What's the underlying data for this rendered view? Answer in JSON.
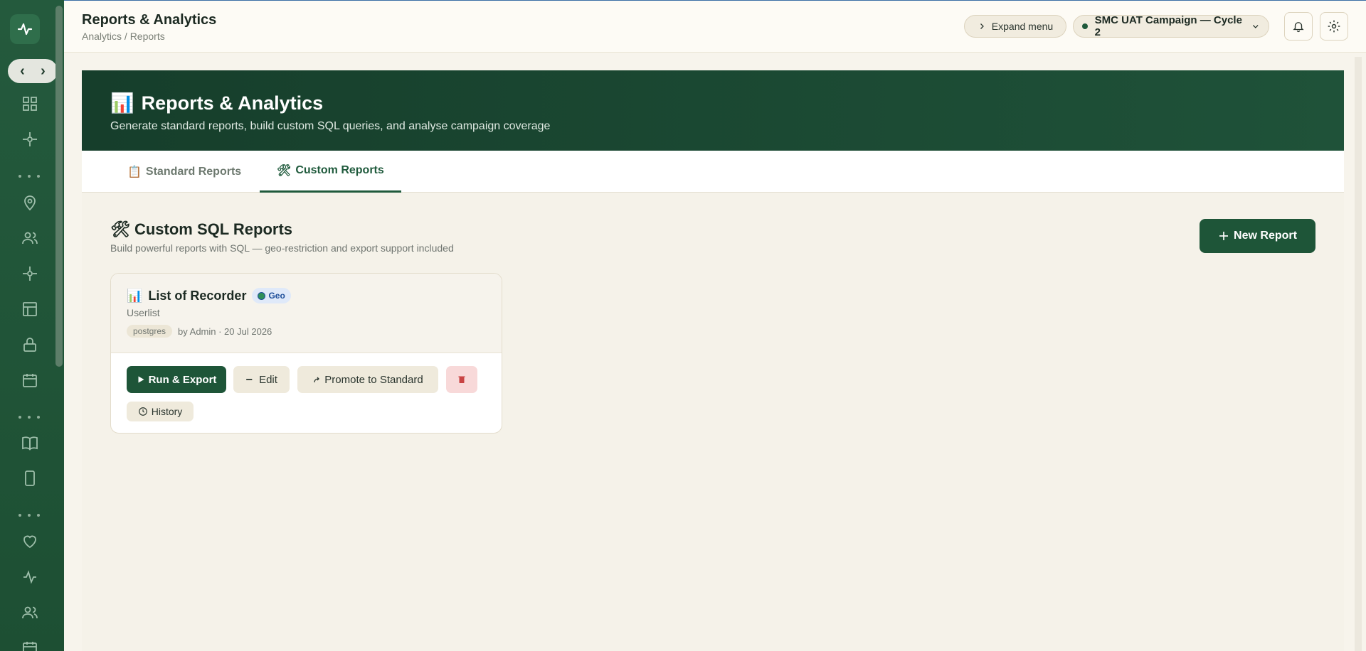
{
  "app": {
    "page_title": "Reports & Analytics",
    "breadcrumb": "Analytics / Reports"
  },
  "topbar": {
    "expand_label": "Expand menu",
    "campaign_label": "SMC UAT Campaign — Cycle 2"
  },
  "sidebar": {
    "toggle_left": "‹",
    "toggle_right": "›",
    "items": [
      {
        "icon": "dashboard-grid-icon"
      },
      {
        "icon": "crosshair-icon"
      },
      {
        "icon": "location-pin-icon"
      },
      {
        "icon": "users-icon"
      },
      {
        "icon": "crosshair-icon"
      },
      {
        "icon": "layout-icon"
      },
      {
        "icon": "lock-icon"
      },
      {
        "icon": "calendar-icon"
      },
      {
        "icon": "book-icon"
      },
      {
        "icon": "mobile-icon"
      },
      {
        "icon": "heart-icon"
      },
      {
        "icon": "activity-icon"
      },
      {
        "icon": "users-icon"
      },
      {
        "icon": "calendar-icon"
      }
    ]
  },
  "hero": {
    "emoji": "📊",
    "title": "Reports & Analytics",
    "subtitle": "Generate standard reports, build custom SQL queries, and analyse campaign coverage"
  },
  "tabs": [
    {
      "emoji": "📋",
      "label": "Standard Reports",
      "active": false
    },
    {
      "emoji": "🛠",
      "label": "Custom Reports",
      "active": true
    }
  ],
  "section": {
    "emoji": "🛠",
    "title": "Custom SQL Reports",
    "subtitle": "Build powerful reports with SQL — geo-restriction and export support included",
    "new_report_label": "New Report"
  },
  "report_card": {
    "emoji": "📊",
    "title": "List of Recorder",
    "badge": "Geo",
    "description": "Userlist",
    "db_tag": "postgres",
    "meta": "by Admin · 20 Jul 2026",
    "actions": {
      "run": "Run & Export",
      "edit": "Edit",
      "promote": "Promote to Standard",
      "history": "History"
    }
  },
  "colors": {
    "sidebar": "#1d4f33",
    "primary": "#1e5538",
    "hero_start": "#163e2b",
    "hero_end": "#1f5239",
    "page_bg": "#f5f2e9",
    "danger_bg": "#f8d9d9",
    "geo_badge": "#dfe9f9"
  }
}
